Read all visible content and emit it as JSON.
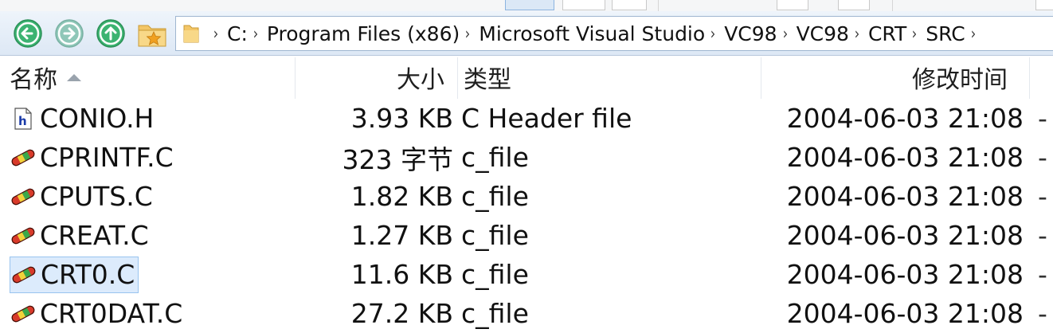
{
  "toolbar": {
    "buttons": [
      "view-details",
      "view-list",
      "view-icons"
    ]
  },
  "nav": {
    "back_icon": "back-arrow-icon",
    "forward_icon": "forward-arrow-icon",
    "up_icon": "up-arrow-icon",
    "recent_icon": "star-folder-icon",
    "breadcrumb": [
      "C:",
      "Program Files (x86)",
      "Microsoft Visual Studio",
      "VC98",
      "VC98",
      "CRT",
      "SRC"
    ],
    "sep": "›"
  },
  "columns": {
    "name": "名称",
    "size": "大小",
    "type": "类型",
    "modified": "修改时间"
  },
  "files": [
    {
      "name": "CONIO.H",
      "size": "3.93 KB",
      "type": "C Header file",
      "modified": "2004-06-03  21:08",
      "extra": "-",
      "icon": "h-file-icon",
      "selected": false
    },
    {
      "name": "CPRINTF.C",
      "size": "323 字节",
      "type": "c_file",
      "modified": "2004-06-03  21:08",
      "extra": "-",
      "icon": "c-file-icon",
      "selected": false
    },
    {
      "name": "CPUTS.C",
      "size": "1.82 KB",
      "type": "c_file",
      "modified": "2004-06-03  21:08",
      "extra": "-",
      "icon": "c-file-icon",
      "selected": false
    },
    {
      "name": "CREAT.C",
      "size": "1.27 KB",
      "type": "c_file",
      "modified": "2004-06-03  21:08",
      "extra": "-",
      "icon": "c-file-icon",
      "selected": false
    },
    {
      "name": "CRT0.C",
      "size": "11.6 KB",
      "type": "c_file",
      "modified": "2004-06-03  21:08",
      "extra": "-",
      "icon": "c-file-icon",
      "selected": true
    },
    {
      "name": "CRT0DAT.C",
      "size": "27.2 KB",
      "type": "c_file",
      "modified": "2004-06-03  21:08",
      "extra": "-",
      "icon": "c-file-icon",
      "selected": false
    }
  ],
  "colors": {
    "nav_green": "#3cb371",
    "nav_teal": "#8fc7b8",
    "selection": "#dcebfc"
  }
}
